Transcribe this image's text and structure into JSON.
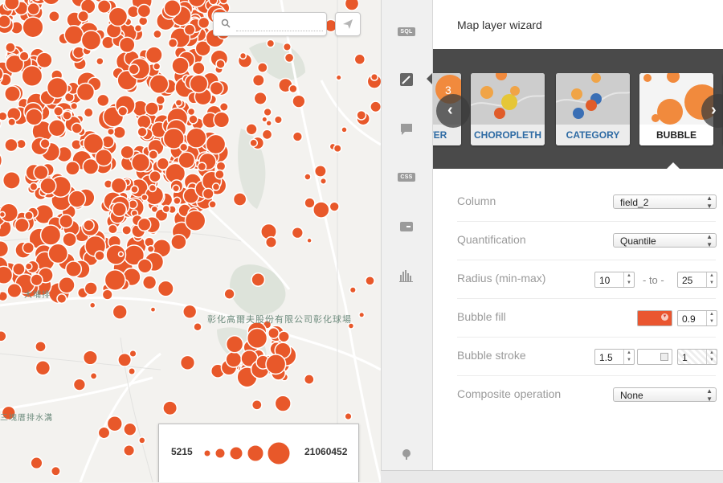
{
  "map": {
    "search_placeholder": "",
    "labels": [
      "彰化高爾夫股份有限公司彰化球場",
      "大埔排",
      "三塊厝排水溝"
    ],
    "legend": {
      "min_value": "5215",
      "max_value": "21060452"
    },
    "marker_color": "#e8582a"
  },
  "toolbar": {
    "items": [
      {
        "name": "sql-icon",
        "tag": "SQL"
      },
      {
        "name": "wizard-icon",
        "tag": ""
      },
      {
        "name": "infowindow-icon",
        "tag": ""
      },
      {
        "name": "css-icon",
        "tag": "CSS"
      },
      {
        "name": "legend-icon",
        "tag": ""
      },
      {
        "name": "filter-icon",
        "tag": ""
      }
    ],
    "bottom_icon": "add-layer-icon"
  },
  "panel": {
    "title": "Map layer wizard",
    "visualizations": [
      {
        "label": "CLUSTER",
        "selected": false
      },
      {
        "label": "CHOROPLETH",
        "selected": false
      },
      {
        "label": "CATEGORY",
        "selected": false
      },
      {
        "label": "BUBBLE",
        "selected": true
      }
    ],
    "rows": {
      "column": {
        "label": "Column",
        "value": "field_2"
      },
      "quantification": {
        "label": "Quantification",
        "value": "Quantile"
      },
      "radius": {
        "label": "Radius (min-max)",
        "min": "10",
        "to_text": "- to -",
        "max": "25"
      },
      "fill": {
        "label": "Bubble fill",
        "color": "#ea5630",
        "opacity": "0.9"
      },
      "stroke": {
        "label": "Bubble stroke",
        "width": "1.5",
        "opacity": "1"
      },
      "composite": {
        "label": "Composite operation",
        "value": "None"
      }
    }
  }
}
